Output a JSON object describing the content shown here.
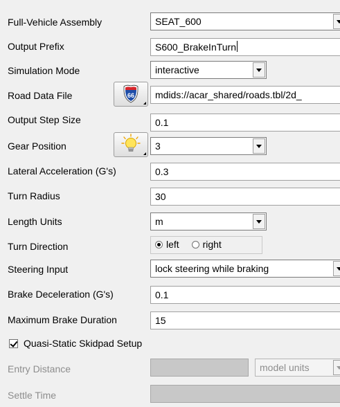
{
  "form": {
    "full_vehicle_assembly": {
      "label": "Full-Vehicle Assembly",
      "value": "SEAT_600"
    },
    "output_prefix": {
      "label": "Output Prefix",
      "value": "S600_BrakeInTurn"
    },
    "simulation_mode": {
      "label": "Simulation Mode",
      "value": "interactive"
    },
    "road_data_file": {
      "label": "Road Data File",
      "value": "mdids://acar_shared/roads.tbl/2d_",
      "button_icon": "route-66-road-sign-icon"
    },
    "output_step_size": {
      "label": "Output Step Size",
      "value": "0.1"
    },
    "gear_position": {
      "label": "Gear Position",
      "value": "3",
      "button_icon": "lightbulb-icon"
    },
    "lateral_acceleration": {
      "label": "Lateral Acceleration (G's)",
      "value": "0.3"
    },
    "turn_radius": {
      "label": "Turn Radius",
      "value": "30"
    },
    "length_units": {
      "label": "Length Units",
      "value": "m"
    },
    "turn_direction": {
      "label": "Turn Direction",
      "options": [
        "left",
        "right"
      ],
      "selected": "left"
    },
    "steering_input": {
      "label": "Steering Input",
      "value": "lock steering while braking"
    },
    "brake_deceleration": {
      "label": "Brake Deceleration (G's)",
      "value": "0.1"
    },
    "maximum_brake_duration": {
      "label": "Maximum Brake Duration",
      "value": "15"
    },
    "quasi_static": {
      "label": "Quasi-Static Skidpad Setup",
      "checked": true
    },
    "entry_distance": {
      "label": "Entry Distance",
      "value": "",
      "units": "model units"
    },
    "settle_time": {
      "label": "Settle Time",
      "value": ""
    }
  },
  "colors": {
    "background": "#f0f0f0",
    "disabled_text": "#8d8d8d",
    "disabled_field": "#c8c8c8",
    "road_sign_blue": "#1f4ea8",
    "road_sign_red": "#d8262b"
  }
}
